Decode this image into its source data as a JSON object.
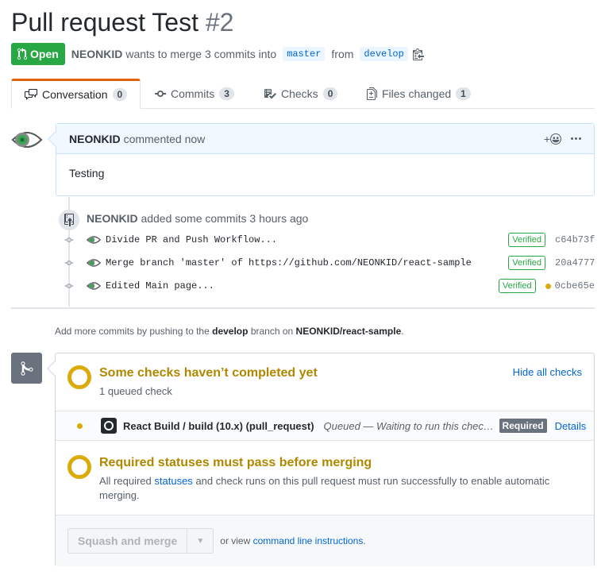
{
  "pr": {
    "title": "Pull request Test",
    "number": "#2",
    "state": "Open",
    "author": "NEONKID",
    "merge_text": "wants to merge 3 commits into",
    "base_branch": "master",
    "from_text": "from",
    "head_branch": "develop"
  },
  "tabs": [
    {
      "label": "Conversation",
      "count": "0",
      "icon": "comment-discussion-icon"
    },
    {
      "label": "Commits",
      "count": "3",
      "icon": "git-commit-icon"
    },
    {
      "label": "Checks",
      "count": "0",
      "icon": "checklist-icon"
    },
    {
      "label": "Files changed",
      "count": "1",
      "icon": "file-diff-icon"
    }
  ],
  "comment": {
    "author": "NEONKID",
    "action": "commented now",
    "body": "Testing",
    "reaction_label": "+"
  },
  "push_event": {
    "author": "NEONKID",
    "text": "added some commits 3 hours ago"
  },
  "commits": [
    {
      "message": "Divide PR and Push Workflow...",
      "verified": "Verified",
      "sha": "c64b73f",
      "pending": false
    },
    {
      "message": "Merge branch 'master' of https://github.com/NEONKID/react-sample",
      "verified": "Verified",
      "sha": "20a4777",
      "pending": false
    },
    {
      "message": "Edited Main page...",
      "verified": "Verified",
      "sha": "0cbe65e",
      "pending": true
    }
  ],
  "hint": {
    "prefix": "Add more commits by pushing to the",
    "branch": "develop",
    "middle": "branch on",
    "repo": "NEONKID/react-sample",
    "suffix": "."
  },
  "checks": {
    "title": "Some checks haven’t completed yet",
    "subtitle": "1 queued check",
    "toggle": "Hide all checks",
    "items": [
      {
        "name": "React Build / build (10.x) (pull_request)",
        "status": "Queued — Waiting to run this chec…",
        "badge": "Required",
        "details": "Details"
      }
    ]
  },
  "required_status": {
    "title": "Required statuses must pass before merging",
    "desc_prefix": "All required",
    "desc_link": "statuses",
    "desc_suffix": "and check runs on this pull request must run successfully to enable automatic merging."
  },
  "merge": {
    "button": "Squash and merge",
    "alt_prefix": "or view",
    "alt_link": "command line instructions",
    "alt_suffix": "."
  },
  "colors": {
    "open": "#28a745",
    "pending": "#dbab09",
    "link": "#0366d6",
    "tab_accent": "#e36209"
  }
}
